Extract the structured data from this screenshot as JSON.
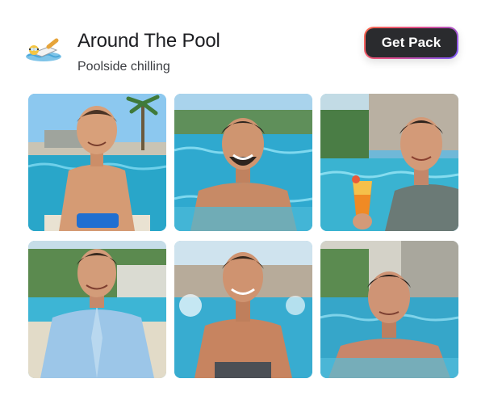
{
  "pack": {
    "title": "Around The Pool",
    "subtitle": "Poolside chilling",
    "icon": "swimmer-icon",
    "cta_label": "Get Pack"
  },
  "colors": {
    "title": "#1c1d21",
    "subtitle": "#3b3d42",
    "button_bg": "#2a2b2e",
    "button_border_gradient": [
      "#ff6a4a",
      "#e24d8c",
      "#7a5cff"
    ],
    "button_text": "#ffffff"
  },
  "photos": [
    {
      "name": "photo-man-sitting-poolside-edge"
    },
    {
      "name": "photo-man-in-pool-smiling"
    },
    {
      "name": "photo-man-selfie-with-cocktail"
    },
    {
      "name": "photo-man-blue-shirt-poolside"
    },
    {
      "name": "photo-man-in-pool-splashing"
    },
    {
      "name": "photo-man-in-pool-resort"
    }
  ]
}
